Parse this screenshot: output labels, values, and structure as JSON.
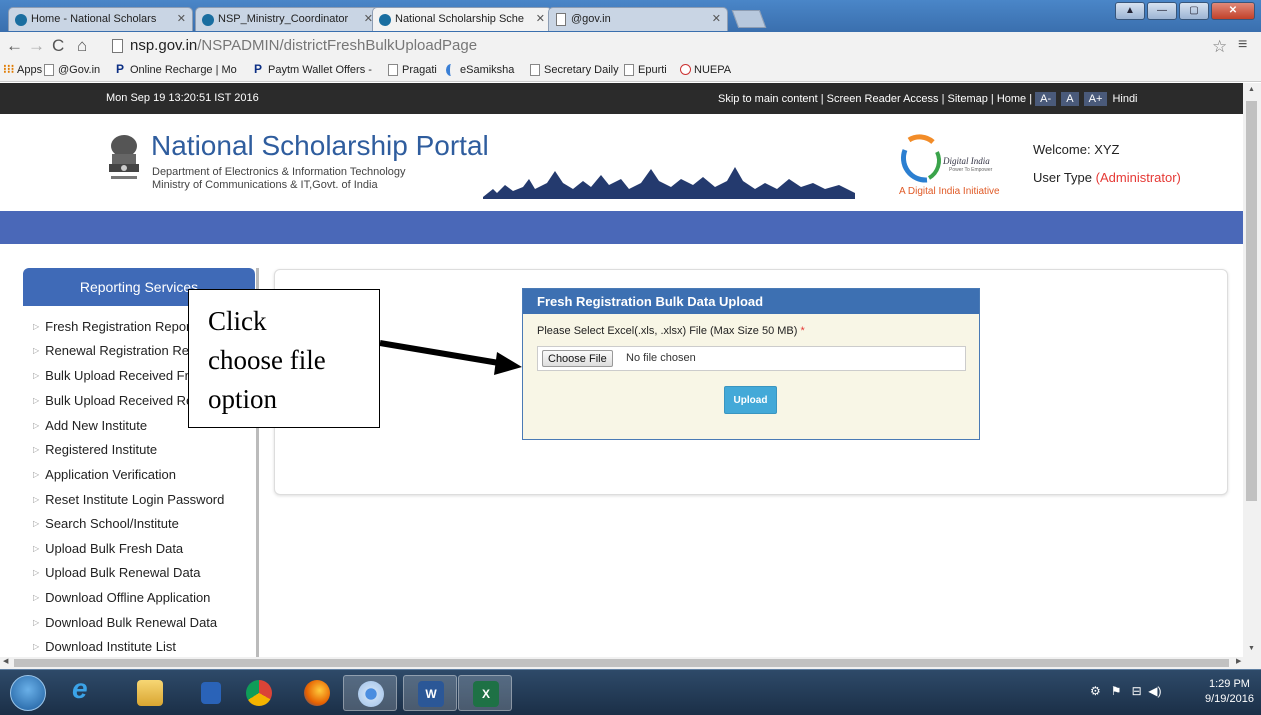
{
  "browser": {
    "tabs": [
      {
        "label": "Home - National Scholars",
        "active": false
      },
      {
        "label": "NSP_Ministry_Coordinator",
        "active": false
      },
      {
        "label": "National Scholarship Sche",
        "active": true
      },
      {
        "label": "@gov.in",
        "active": false
      }
    ],
    "url_host": "nsp.gov.in",
    "url_path": "/NSPADMIN/districtFreshBulkUploadPage",
    "bookmarks": [
      "Apps",
      "@Gov.in",
      "Online Recharge | Mo",
      "Paytm Wallet Offers -",
      "Pragati",
      "eSamiksha",
      "Secretary Daily",
      "Epurti",
      "NUEPA"
    ]
  },
  "topbar": {
    "datetime": "Mon Sep 19 13:20:51 IST 2016",
    "links": "Skip to main content | Screen Reader Access | Sitemap | Home |",
    "font_buttons": [
      "A-",
      "A",
      "A+"
    ],
    "language": "Hindi"
  },
  "header": {
    "title": "National Scholarship Portal",
    "subtitle1": "Department of Electronics & Information Technology",
    "subtitle2": "Ministry of Communications & IT,Govt. of India",
    "digital_india_logo": "Digital India",
    "digital_india_tagline": "Power To Empower",
    "digital_india_initiative": "A Digital India Initiative",
    "welcome_label": "Welcome:",
    "welcome_user": "XYZ",
    "usertype_label": "User Type",
    "usertype_value": "(Administrator)"
  },
  "sidebar": {
    "heading": "Reporting Services",
    "items": [
      "Fresh Registration Report",
      "Renewal Registration Report",
      "Bulk Upload Received Fresh",
      "Bulk Upload Received Renewal",
      "Add New Institute",
      "Registered Institute",
      "Application Verification",
      "Reset Institute Login Password",
      "Search School/Institute",
      "Upload Bulk Fresh Data",
      "Upload Bulk Renewal Data",
      "Download Offline Application",
      "Download Bulk Renewal Data",
      "Download Institute List"
    ]
  },
  "upload": {
    "heading": "Fresh Registration Bulk Data Upload",
    "label": "Please Select Excel(.xls, .xlsx) File (Max Size 50 MB)",
    "required": "*",
    "choose_button": "Choose File",
    "no_file": "No file chosen",
    "upload_button": "Upload"
  },
  "callout": {
    "lines": [
      "Click",
      "choose  file",
      "option"
    ]
  },
  "taskbar": {
    "clock_time": "1:29 PM",
    "clock_date": "9/19/2016"
  }
}
